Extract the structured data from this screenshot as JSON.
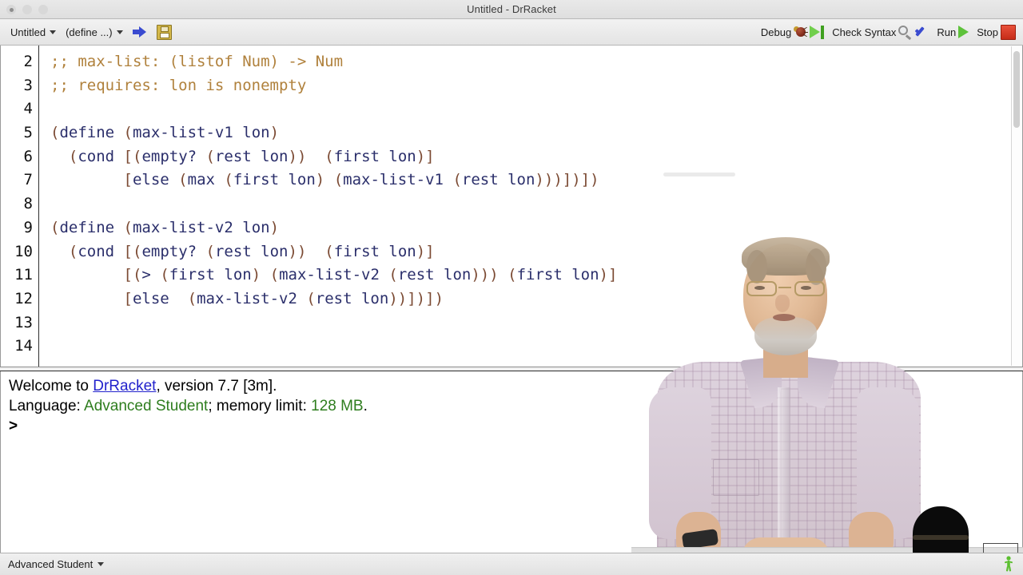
{
  "window": {
    "title": "Untitled - DrRacket",
    "traffic_lights": [
      "close",
      "minimize",
      "zoom"
    ]
  },
  "toolbar": {
    "file_menu_label": "Untitled",
    "definition_menu_label": "(define ...)",
    "save_icon": "floppy-disk-icon",
    "jump_icon": "blue-right-arrow-icon",
    "debug_label": "Debug",
    "check_syntax_label": "Check Syntax",
    "run_label": "Run",
    "stop_label": "Stop"
  },
  "editor": {
    "first_visible_line": 2,
    "line_numbers": [
      "2",
      "3",
      "4",
      "5",
      "6",
      "7",
      "8",
      "9",
      "10",
      "11",
      "12",
      "13",
      "14"
    ],
    "lines": [
      ";; max-list: (listof Num) -> Num",
      ";; requires: lon is nonempty",
      "",
      "(define (max-list-v1 lon)",
      "  (cond [(empty? (rest lon))  (first lon)]",
      "        [else (max (first lon) (max-list-v1 (rest lon)))])])",
      "",
      "(define (max-list-v2 lon)",
      "  (cond [(empty? (rest lon))  (first lon)]",
      "        [(> (first lon) (max-list-v2 (rest lon))) (first lon)]",
      "        [else  (max-list-v2 (rest lon))])])",
      "",
      ""
    ]
  },
  "interactions": {
    "welcome_prefix": "Welcome to ",
    "welcome_link": "DrRacket",
    "welcome_suffix": ", version 7.7 [3m].",
    "language_prefix": "Language: ",
    "language_name": "Advanced Student",
    "memory_prefix": "; memory limit: ",
    "memory_value": "128 MB",
    "memory_suffix": ".",
    "prompt": ">"
  },
  "statusbar": {
    "language_label": "Advanced Student",
    "runner_icon": "running-man-icon"
  },
  "colors": {
    "comment": "#b0813c",
    "paren": "#7b4a33",
    "identifier": "#2b2f6b",
    "link": "#2222cc",
    "green_text": "#2e7d1e",
    "stop_red": "#c62c18",
    "run_green": "#5ec23b"
  }
}
